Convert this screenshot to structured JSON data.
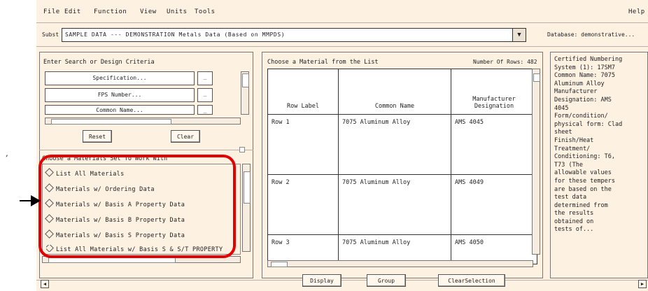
{
  "menu": {
    "items": [
      "File",
      "Edit",
      "Function",
      "View",
      "Units",
      "Tools"
    ],
    "help": "Help"
  },
  "select": {
    "label": "Subst",
    "value": "SAMPLE DATA --- DEMONSTRATION Metals Data (Based on MMPDS)",
    "database_label": "Database: demonstrative..."
  },
  "search": {
    "title": "Enter Search or Design Criteria",
    "fields": [
      "Specification...",
      "FPS Number...",
      "Common Name..."
    ],
    "reset_label": "Reset",
    "clear_label": "Clear"
  },
  "datasets": {
    "title": "Choose a Materials Set To Work With",
    "items": [
      "List All Materials",
      "Materials w/ Ordering Data",
      "Materials w/ Basis A Property Data",
      "Materials w/ Basis B Property Data",
      "Materials w/ Basis S Property Data",
      "List All Materials w/ Basis S & S/T PROPERTY"
    ]
  },
  "table": {
    "title": "Choose a Material from the List",
    "count": "Number Of Rows: 482",
    "headers": [
      "Row Label",
      "Common Name",
      "Manufacturer Designation"
    ],
    "rows": [
      [
        "Row 1",
        "7075 Aluminum Alloy",
        "AMS 4045"
      ],
      [
        "Row 2",
        "7075 Aluminum Alloy",
        "AMS 4049"
      ],
      [
        "Row 3",
        "7075 Aluminum Alloy",
        "AMS 4050"
      ]
    ]
  },
  "info": {
    "text": "Certified Numbering\nSystem (1): 17SM7\nCommon Name: 7075\n Aluminum Alloy\nManufacturer\nDesignation: AMS\n 4045\nForm/condition/\nphysical form: Clad\n sheet\nFinish/Heat\nTreatment/\nConditioning: T6,\n T73 (The\n allowable values\n for these tempers\n are based on the\n test data\n determined from\n the results\n obtained on\n tests of..."
  },
  "buttons": {
    "display": "Display",
    "group": "Group",
    "clear_selection": "ClearSelection"
  },
  "annotations": {
    "highlight_color": "#e30000",
    "arrow_color": "#000000"
  }
}
